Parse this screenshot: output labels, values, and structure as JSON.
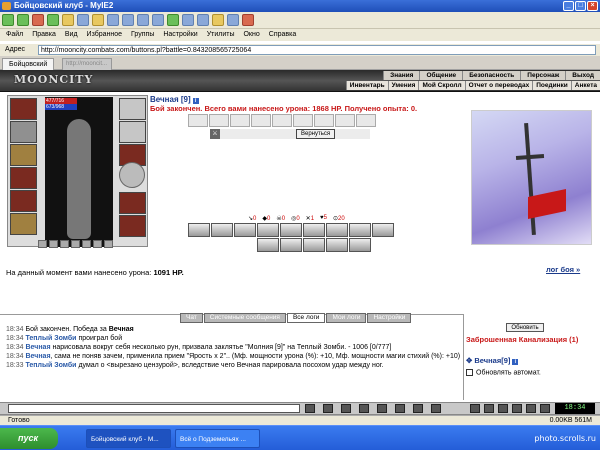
{
  "window": {
    "title": "Бойцовский клуб - MyIE2"
  },
  "menu": [
    "Файл",
    "Правка",
    "Вид",
    "Избранное",
    "Группы",
    "Настройки",
    "Утилиты",
    "Окно",
    "Справка"
  ],
  "address": {
    "label": "Адрес",
    "url": "http://mooncity.combats.com/buttons.pl?battle=0.843208565725064"
  },
  "tabs": {
    "active": "Бойцовский",
    "other": "http://mooncit..."
  },
  "header": {
    "logo": "MOONCITY",
    "nav_top": [
      "Знания",
      "Общение",
      "Безопасность",
      "Персонаж",
      "Выход"
    ],
    "nav_bottom": [
      "Инвентарь",
      "Умения",
      "Мой Скролл",
      "Отчет о переводах",
      "Поединки",
      "Анкета"
    ]
  },
  "character": {
    "name": "Вечная [9]",
    "hp": "477/716",
    "mp": "673/968"
  },
  "battle": {
    "result": "Бой закончен. Всего вами нанесено урона: 1868 HP. Получено опыта: 0.",
    "back_button": "Вернуться",
    "counters": [
      {
        "icon": "sword-icon",
        "value": "0"
      },
      {
        "icon": "shield-icon",
        "value": "0"
      },
      {
        "icon": "skull-icon",
        "value": "0"
      },
      {
        "icon": "target-icon",
        "value": "0"
      },
      {
        "icon": "cross-icon",
        "value": "1"
      },
      {
        "icon": "heart-icon",
        "value": "5"
      },
      {
        "icon": "clock-icon",
        "value": "20"
      }
    ],
    "damage_label": "На данный момент вами нанесено урона:",
    "damage_value": "1091 HP."
  },
  "log_link": "лог боя »",
  "chat": {
    "tabs": [
      "Чат",
      "Системные сообщения",
      "Все логи",
      "Мои логи",
      "Настройки"
    ],
    "active_tab": "Все логи",
    "lines": [
      {
        "time": "18:34",
        "text": " Бой закончен. Победа за ",
        "bold": "Вечная",
        "tail": ""
      },
      {
        "time": "18:34",
        "text": " ",
        "bold": "Теплый Зомби",
        "tail": " проиграл бой"
      },
      {
        "time": "18:34",
        "text": " ",
        "bold": "Вечная",
        "tail": " нарисовала вокруг себя несколько рун, призвала заклятье \"Молния [9]\" на Теплый Зомби. - 1006 [0/777]"
      },
      {
        "time": "18:34",
        "text": " ",
        "bold": "Вечная",
        "tail": ", сама не поняв зачем, применила прием \"Ярость x 2\".. (Мф. мощности урона (%): +10, Мф. мощности магии стихий (%): +10)"
      },
      {
        "time": "18:33",
        "text": " ",
        "bold": "Теплый Зомби",
        "tail": " думал о <вырезано цензурой>, вследствие чего Вечная парировала посохом удар между ног."
      }
    ]
  },
  "side": {
    "refresh": "Обновить",
    "location": "Заброшенная Канализация (1)",
    "occupant": "Вечная[9]",
    "auto_refresh": "Обновлять автомат."
  },
  "clock": "18:34",
  "status": {
    "text": "Готово",
    "memory": "0.00KB  561M"
  },
  "taskbar": {
    "start": "пуск",
    "items": [
      "Бойцовский клуб - M...",
      "Всё о Подземельях ..."
    ],
    "watermark": "photo.scrolls.ru"
  }
}
